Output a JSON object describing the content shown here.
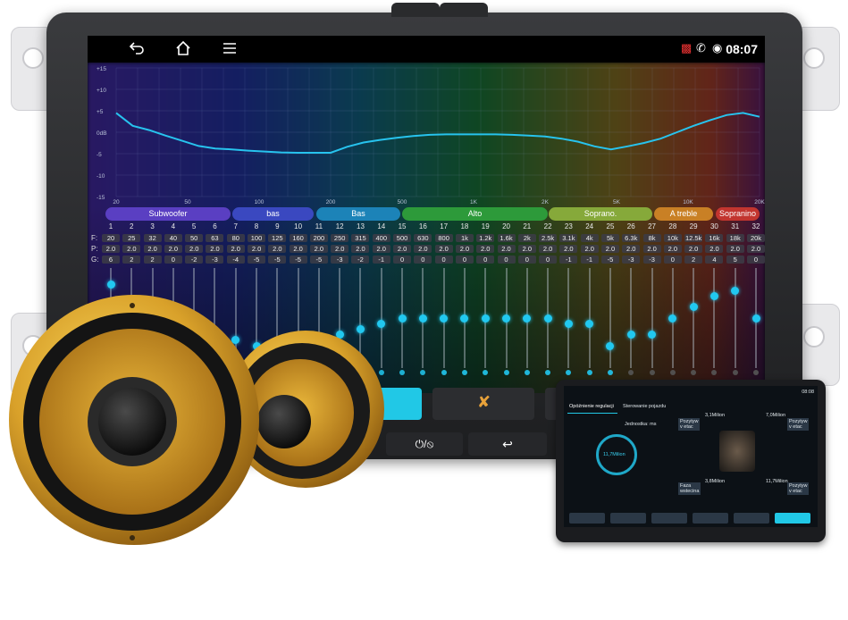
{
  "status_bar": {
    "time": "08:07",
    "back_icon": "back-arrow-icon",
    "home_icon": "home-icon",
    "menu_icon": "menu-icon"
  },
  "graph": {
    "y_labels": [
      "+15",
      "+10",
      "+5",
      "0dB",
      "-5",
      "-10",
      "-15"
    ],
    "x_labels": [
      "20",
      "50",
      "100",
      "200",
      "500",
      "1K",
      "2K",
      "5K",
      "10K",
      "20K"
    ],
    "curve_points_db": [
      4.5,
      1.5,
      0.5,
      -0.8,
      -2,
      -3.2,
      -3.8,
      -4,
      -4.3,
      -4.5,
      -4.7,
      -4.8,
      -4.8,
      -4.8,
      -3.4,
      -2.4,
      -1.8,
      -1.3,
      -0.9,
      -0.6,
      -0.5,
      -0.5,
      -0.5,
      -0.5,
      -0.6,
      -0.8,
      -1,
      -1.5,
      -2.2,
      -3.3,
      -4,
      -3.3,
      -2.5,
      -1.5,
      0,
      1.5,
      2.8,
      4,
      4.5,
      3.6
    ]
  },
  "bands": [
    {
      "label": "Subwoofer",
      "color": "#5a3fc2"
    },
    {
      "label": "bas",
      "color": "#3a48c0"
    },
    {
      "label": "Bas",
      "color": "#1c83b8"
    },
    {
      "label": "Alto",
      "color": "#2d9a3a"
    },
    {
      "label": "Soprano.",
      "color": "#86a93a"
    },
    {
      "label": "A treble",
      "color": "#c98025"
    },
    {
      "label": "Sopranino",
      "color": "#c2352f"
    }
  ],
  "row_labels": {
    "f": "F:",
    "p": "P:",
    "g": "G:"
  },
  "channels": {
    "numbers": [
      "1",
      "2",
      "3",
      "4",
      "5",
      "6",
      "7",
      "8",
      "9",
      "10",
      "11",
      "12",
      "13",
      "14",
      "15",
      "16",
      "17",
      "18",
      "19",
      "20",
      "21",
      "22",
      "23",
      "24",
      "25",
      "26",
      "27",
      "28",
      "29",
      "30",
      "31",
      "32"
    ],
    "freqs": [
      "20",
      "25",
      "32",
      "40",
      "50",
      "63",
      "80",
      "100",
      "125",
      "160",
      "200",
      "250",
      "315",
      "400",
      "500",
      "630",
      "800",
      "1k",
      "1.2k",
      "1.6k",
      "2k",
      "2.5k",
      "3.1k",
      "4k",
      "5k",
      "6.3k",
      "8k",
      "10k",
      "12.5k",
      "16k",
      "18k",
      "20k"
    ],
    "p_values": [
      "2.0",
      "2.0",
      "2.0",
      "2.0",
      "2.0",
      "2.0",
      "2.0",
      "2.0",
      "2.0",
      "2.0",
      "2.0",
      "2.0",
      "2.0",
      "2.0",
      "2.0",
      "2.0",
      "2.0",
      "2.0",
      "2.0",
      "2.0",
      "2.0",
      "2.0",
      "2.0",
      "2.0",
      "2.0",
      "2.0",
      "2.0",
      "2.0",
      "2.0",
      "2.0",
      "2.0",
      "2.0"
    ],
    "gains": [
      "6",
      "2",
      "2",
      "0",
      "-2",
      "-3",
      "-4",
      "-5",
      "-5",
      "-5",
      "-5",
      "-3",
      "-2",
      "-1",
      "0",
      "0",
      "0",
      "0",
      "0",
      "0",
      "0",
      "0",
      "-1",
      "-1",
      "-5",
      "-3",
      "-3",
      "0",
      "2",
      "4",
      "5",
      "0"
    ],
    "gain_levels": [
      6,
      2,
      2,
      0,
      -2,
      -3,
      -4,
      -5,
      -5,
      -5,
      -5,
      -3,
      -2,
      -1,
      0,
      0,
      0,
      0,
      0,
      0,
      0,
      0,
      -1,
      -1,
      -5,
      -3,
      -3,
      0,
      2,
      4,
      5,
      0
    ]
  },
  "bottom_bar": {
    "mute_label": "⏻/⦸",
    "back_label": "↩"
  },
  "tablet": {
    "tabs": [
      "Opóźnienie regulacji",
      "Sterowanie pojazdu"
    ],
    "unit_label": "Jednostka: ms",
    "dial_value": "11,7Milion",
    "labels": [
      "3,1Milion",
      "7,0Milion",
      "3,8Milion",
      "11,7Milion"
    ],
    "buttons": [
      "Pozytyw\nv etac",
      "Pozytyw\nv etac",
      "Faza\nwstecina",
      "Pozytyw\nv etac"
    ],
    "time": "08:08"
  }
}
